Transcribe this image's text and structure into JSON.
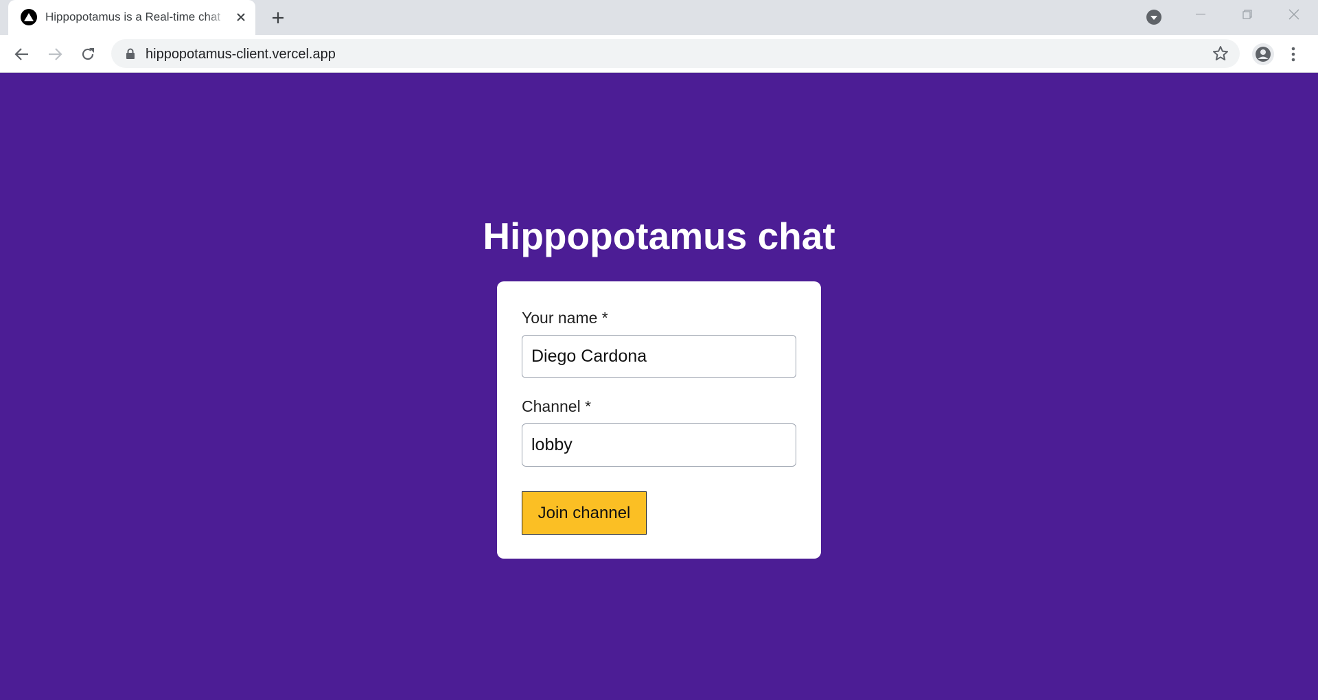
{
  "browser": {
    "tab_title": "Hippopotamus is a Real-time chat",
    "url": "hippopotamus-client.vercel.app",
    "icons": {
      "favicon": "vercel-triangle-icon",
      "close": "close-icon",
      "new_tab": "plus-icon",
      "tab_search": "tab-search-icon",
      "back": "back-arrow-icon",
      "forward": "forward-arrow-icon",
      "reload": "reload-icon",
      "lock": "lock-icon",
      "bookmark": "star-icon",
      "profile": "profile-icon",
      "menu": "kebab-menu-icon"
    }
  },
  "page": {
    "title": "Hippopotamus chat",
    "background_color": "#4c1d95",
    "form": {
      "name_label": "Your name *",
      "name_value": "Diego Cardona",
      "channel_label": "Channel *",
      "channel_value": "lobby",
      "submit_label": "Join channel",
      "submit_color": "#fbbf24"
    }
  }
}
